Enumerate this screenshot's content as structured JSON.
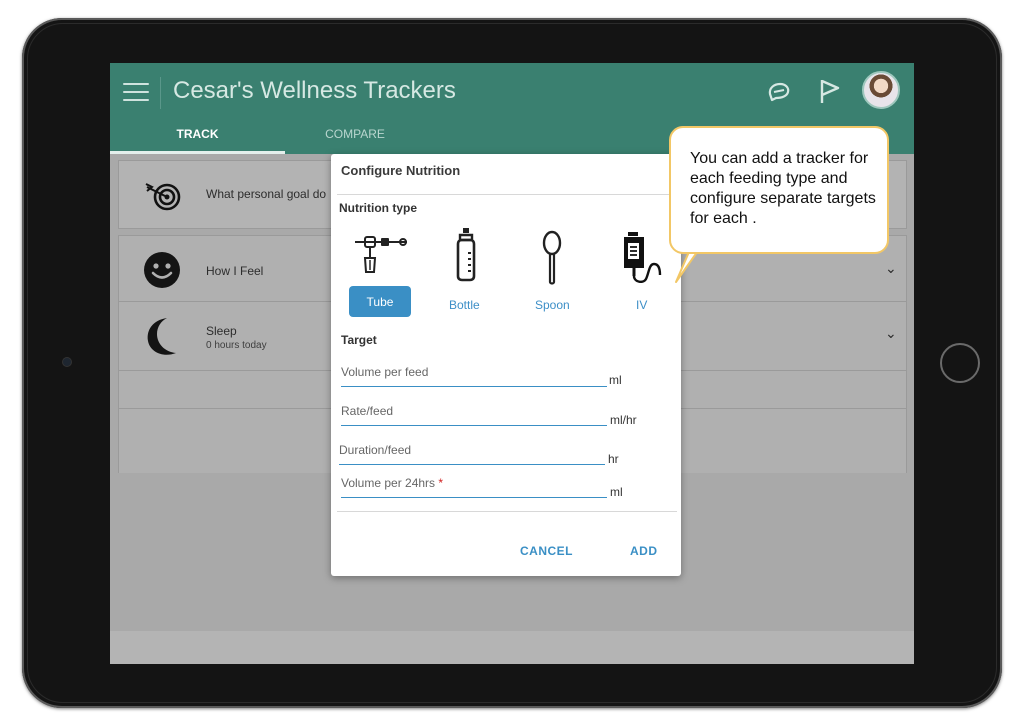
{
  "app": {
    "title": "Cesar's Wellness Trackers"
  },
  "tabs": [
    {
      "label": "TRACK",
      "selected": true
    },
    {
      "label": "COMPARE",
      "selected": false
    }
  ],
  "cards": {
    "goal": {
      "text": "What personal goal do"
    },
    "feel": {
      "label": "How I Feel"
    },
    "sleep": {
      "label": "Sleep",
      "sub": "0 hours today"
    }
  },
  "modal": {
    "title": "Configure Nutrition",
    "nutrition_type_label": "Nutrition type",
    "types": [
      {
        "label": "Tube",
        "icon": "feeding-tube-icon",
        "selected": true
      },
      {
        "label": "Bottle",
        "icon": "bottle-icon",
        "selected": false
      },
      {
        "label": "Spoon",
        "icon": "spoon-icon",
        "selected": false
      },
      {
        "label": "IV",
        "icon": "iv-bag-icon",
        "selected": false
      }
    ],
    "target_label": "Target",
    "fields": [
      {
        "placeholder": "Volume per feed",
        "unit": "ml",
        "required": false
      },
      {
        "placeholder": "Rate/feed",
        "unit": "ml/hr",
        "required": false
      },
      {
        "placeholder": "Duration/feed",
        "unit": "hr",
        "required": false
      },
      {
        "placeholder": "Volume per 24hrs",
        "unit": "ml",
        "required": true,
        "required_mark": "*"
      }
    ],
    "cancel_label": "CANCEL",
    "add_label": "ADD"
  },
  "callout": {
    "text": "You can add a tracker for each feeding type and configure separate targets for each ."
  },
  "colors": {
    "appbar": "#3a8070",
    "accent_blue": "#3a8fc5",
    "callout_border": "#f2c766",
    "required": "#d02020"
  }
}
